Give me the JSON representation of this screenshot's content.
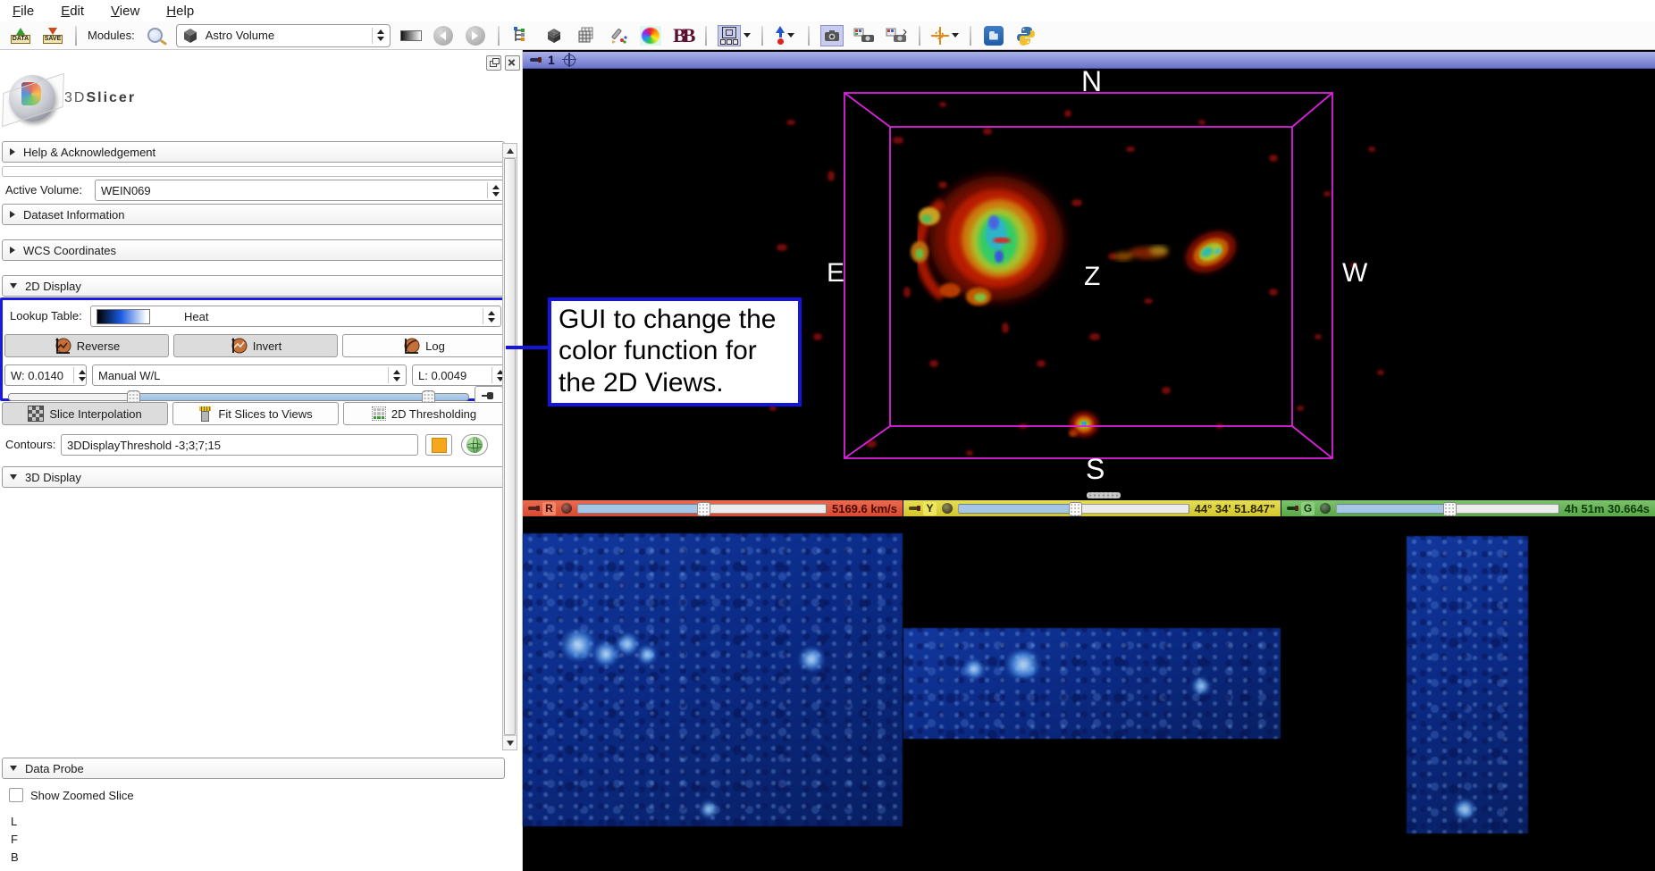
{
  "menu": {
    "items": [
      "File",
      "Edit",
      "View",
      "Help"
    ]
  },
  "toolbar": {
    "data_icon_caption": "DATA",
    "save_icon_caption": "SAVE",
    "modules_label": "Modules:",
    "module_selected": "Astro Volume",
    "bb_logo": "BB"
  },
  "panel": {
    "app_name_prefix": "3D",
    "app_name_suffix": "Slicer",
    "help_header": "Help & Acknowledgement",
    "active_volume_label": "Active Volume:",
    "active_volume_value": "WEIN069",
    "dataset_header": "Dataset Information",
    "wcs_header": "WCS Coordinates",
    "display2d_header": "2D Display",
    "lookup_label": "Lookup Table:",
    "lookup_value": "Heat",
    "reverse_label": "Reverse",
    "invert_label": "Invert",
    "log_label": "Log",
    "window_value": "W: 0.0140",
    "wl_mode": "Manual W/L",
    "level_value": "L: 0.0049",
    "slice_interpolation_label": "Slice Interpolation",
    "fit_slices_label": "Fit Slices to Views",
    "thresholding_label": "2D Thresholding",
    "contours_label": "Contours:",
    "contours_value": "3DDisplayThreshold -3;3;7;15",
    "display3d_header": "3D Display",
    "data_probe_header": "Data Probe",
    "show_zoomed_label": "Show Zoomed Slice",
    "probe_rows": [
      "L",
      "F",
      "B"
    ]
  },
  "annotation": {
    "text": "GUI to change the color function for the 2D Views."
  },
  "view3d": {
    "view_number": "1",
    "labels": {
      "north": "N",
      "south": "S",
      "east": "E",
      "west": "W",
      "z": "Z"
    }
  },
  "slices": [
    {
      "letter": "R",
      "value": "5169.6 km/s",
      "bar_color": "#e0523c",
      "chip_color": "#ef8668",
      "text_color": "#4a0800"
    },
    {
      "letter": "Y",
      "value": "44° 34' 51.847\"",
      "bar_color": "#ddd23a",
      "chip_color": "#ece75e",
      "text_color": "#2e2800"
    },
    {
      "letter": "G",
      "value": "4h 51m 30.664s",
      "bar_color": "#68b558",
      "chip_color": "#8ecc7e",
      "text_color": "#0c3a08"
    }
  ],
  "colors": {
    "accent_blue": "#1b1be0",
    "annotation_border": "#1414dd",
    "wireframe_magenta": "#dd22dd",
    "heat_gradient": [
      "#000000",
      "#1a5ae0",
      "#ffffff"
    ]
  }
}
